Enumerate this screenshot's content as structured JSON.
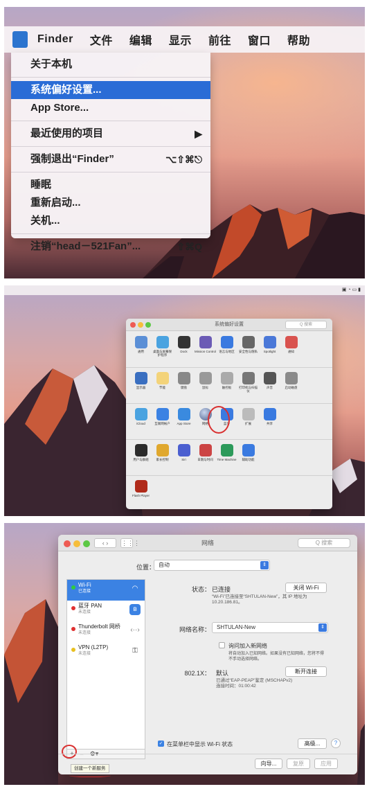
{
  "panel1": {
    "menubar": [
      "Finder",
      "文件",
      "编辑",
      "显示",
      "前往",
      "窗口",
      "帮助"
    ],
    "menu": {
      "about": "关于本机",
      "sysprefs": "系统偏好设置...",
      "appstore": "App Store...",
      "recent": "最近使用的项目",
      "forcequit": "强制退出“Finder”",
      "forcequit_sc": "⌥⇧⌘⎋",
      "sleep": "睡眠",
      "restart": "重新启动...",
      "shutdown": "关机...",
      "logout": "注销“head－521Fan”...",
      "logout_sc": "⇧⌘Q"
    }
  },
  "panel2": {
    "window_title": "系统偏好设置",
    "search_placeholder": "Q 搜索",
    "rows": [
      [
        "通用",
        "桌面与屏幕保护程序",
        "Dock",
        "Mission Control",
        "语言与地区",
        "安全性与隐私",
        "Spotlight",
        "通知"
      ],
      [
        "显示器",
        "节能",
        "键盘",
        "鼠标",
        "触控板",
        "打印机与扫描仪",
        "声音",
        "启动磁盘"
      ],
      [
        "iCloud",
        "互联网帐户",
        "App Store",
        "网络",
        "蓝牙",
        "扩展",
        "共享"
      ],
      [
        "用户与群组",
        "家长控制",
        "Siri",
        "日期与时间",
        "Time Machine",
        "辅助功能"
      ],
      [
        "Flash Player"
      ]
    ]
  },
  "panel3": {
    "window_title": "网络",
    "search_placeholder": "Q 搜索",
    "location_label": "位置：",
    "location_value": "自动",
    "services": [
      {
        "name": "Wi-Fi",
        "status": "已连接",
        "dot": "#2ecc40"
      },
      {
        "name": "蓝牙 PAN",
        "status": "未连接",
        "dot": "#e03030"
      },
      {
        "name": "Thunderbolt 网桥",
        "status": "未连接",
        "dot": "#e03030"
      },
      {
        "name": "VPN (L2TP)",
        "status": "未连接",
        "dot": "#e8c020"
      }
    ],
    "list_buttons": [
      "+",
      "–",
      "⚙▾"
    ],
    "tooltip": "创建一个新服务",
    "status_label": "状态：",
    "status_value": "已连接",
    "wifi_off_button": "关闭 Wi-Fi",
    "status_desc": "“Wi-Fi”已连接至“SHTULAN-New”，其 IP 地址为 10.20.186.81。",
    "network_name_label": "网络名称：",
    "network_name_value": "SHTULAN-New",
    "ask_join_label": "询问加入新网络",
    "ask_join_desc": "将自动加入已知网络。如果没有已知网络，您将不得不手动选择网络。",
    "dot1x_label": "802.1X：",
    "dot1x_value": "默认",
    "disconnect_button": "断开连接",
    "dot1x_desc": "已通过“EAP-PEAP”鉴定 (MSCHAPv2)\n连接时间：01:00:42",
    "show_in_menubar": "在菜单栏中显示 Wi-Fi 状态",
    "advanced_button": "高级...",
    "help": "?",
    "assist_button": "向导...",
    "revert_button": "复原",
    "apply_button": "应用"
  }
}
